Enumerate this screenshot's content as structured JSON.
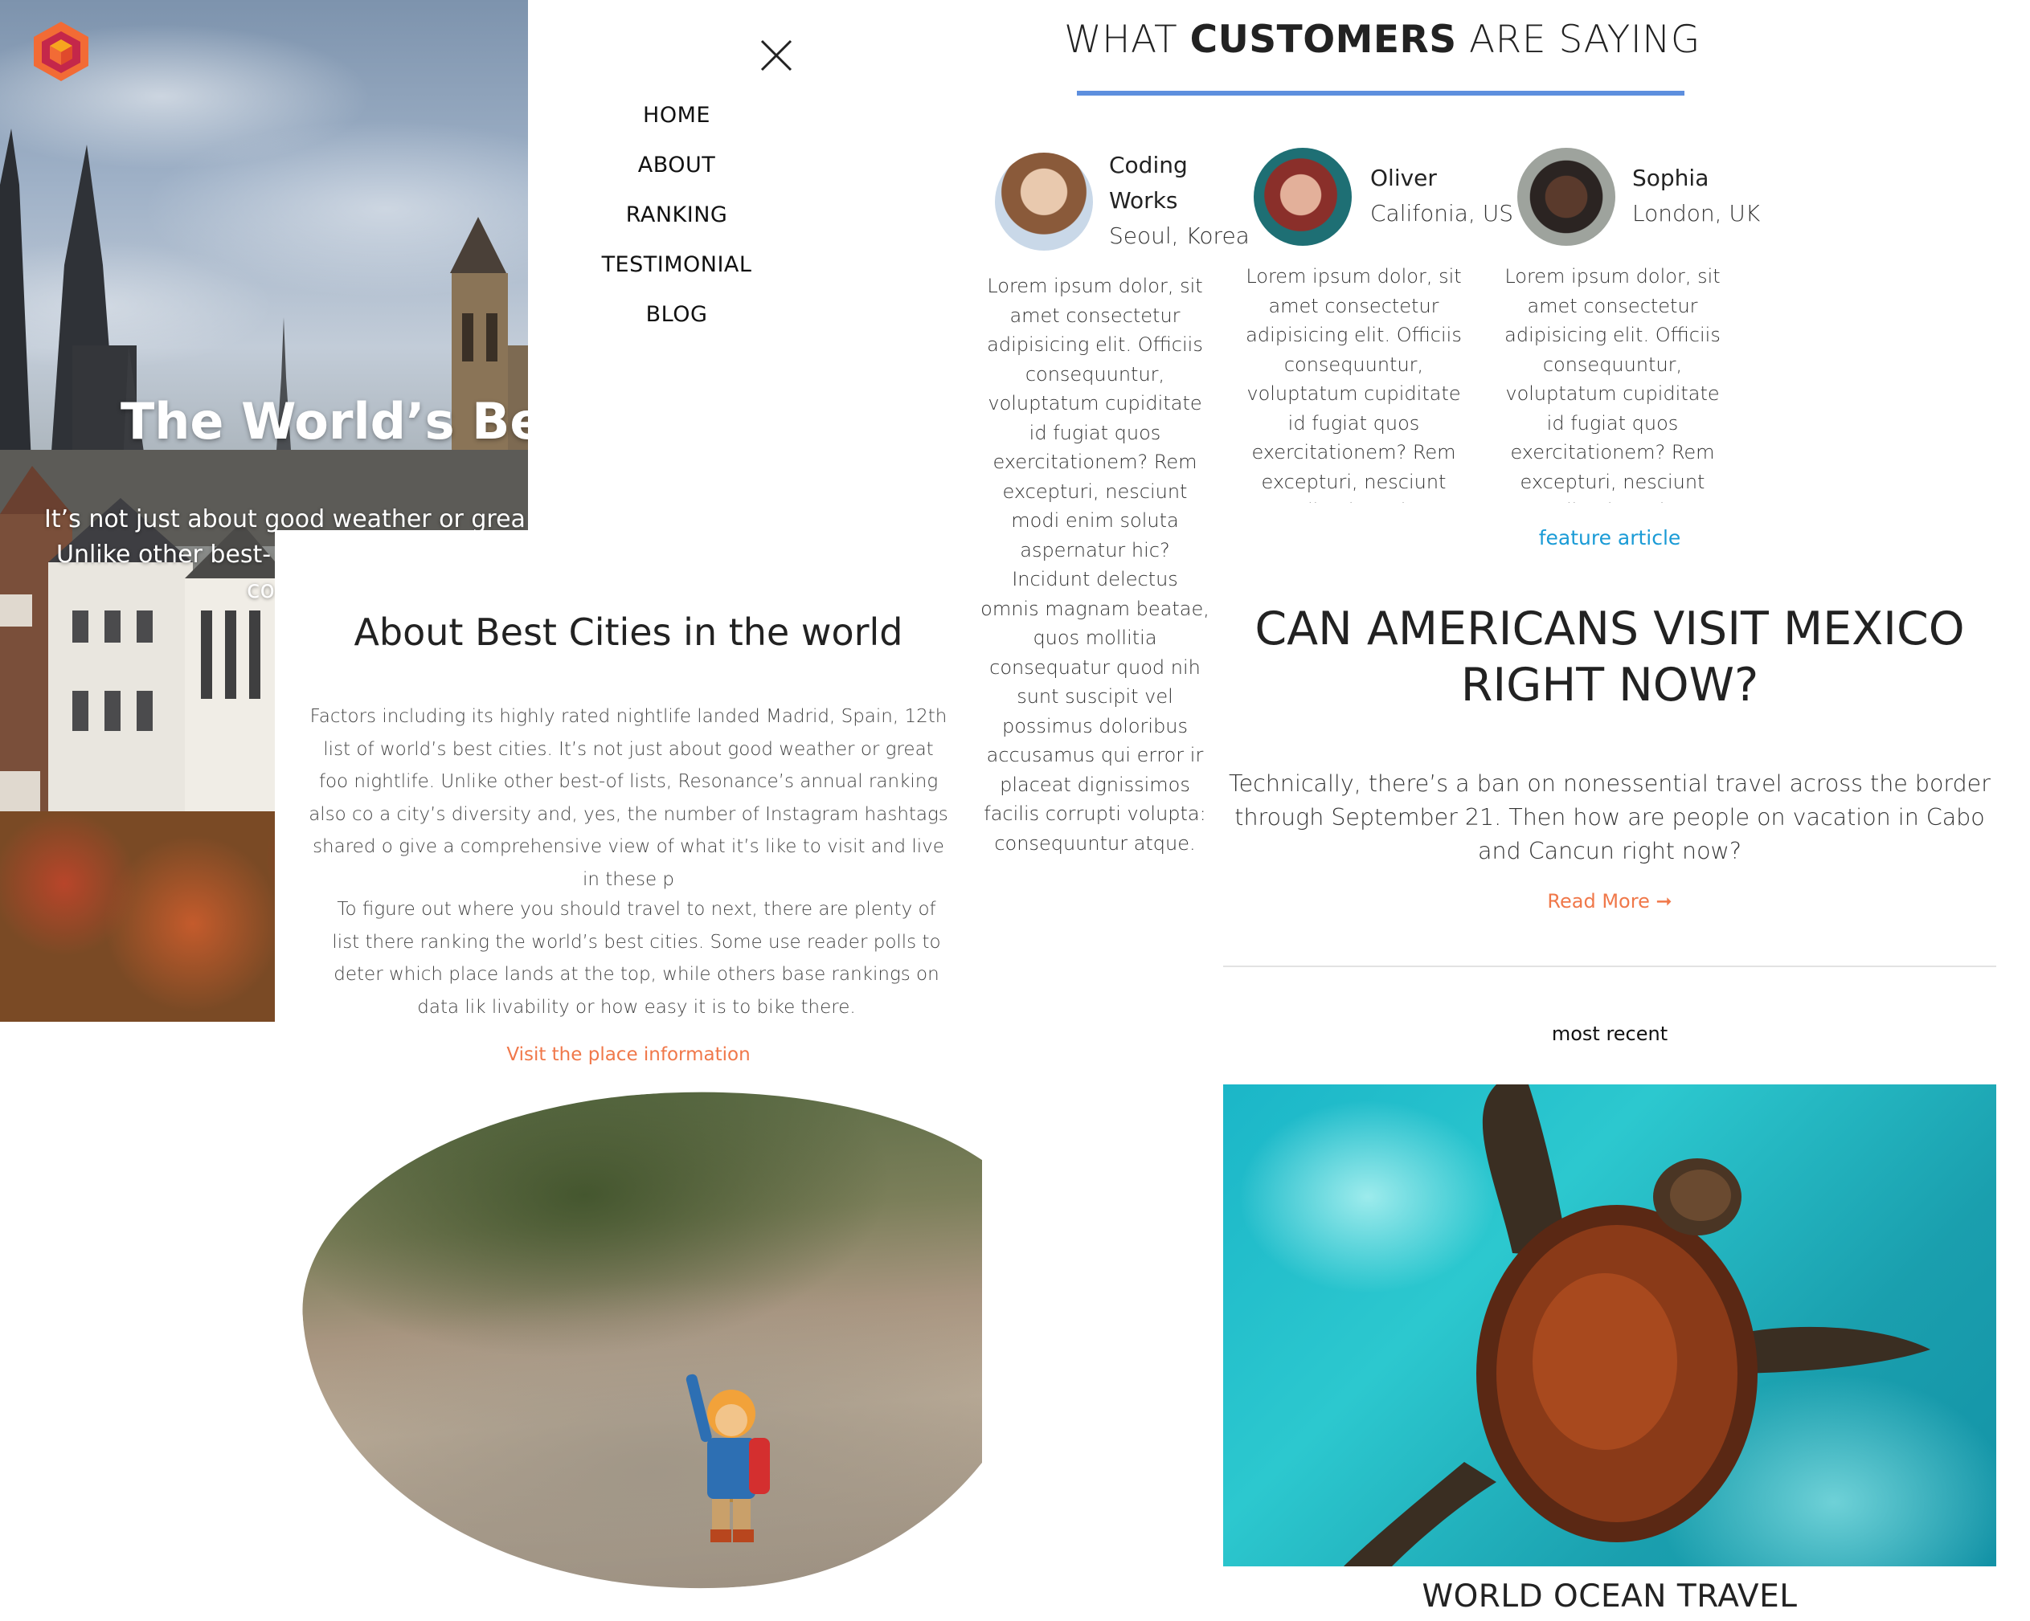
{
  "brand": {
    "logo": "hexagon-cube-logo",
    "colors": {
      "orange": "#f26b35",
      "red": "#c4274a"
    }
  },
  "hero": {
    "title": "The World’s Best",
    "subtitle_lines": [
      "It’s not just about good weather or grea",
      "Unlike other best-",
      "co"
    ]
  },
  "menu": {
    "close_icon": "close-icon",
    "items": [
      "HOME",
      "ABOUT",
      "RANKING",
      "TESTIMONIAL",
      "BLOG"
    ]
  },
  "about": {
    "title": "About Best Cities in the world",
    "paragraph1": "Factors including its highly rated nightlife landed Madrid, Spain, 12th list of world’s best cities. It’s not just about good weather or great foo nightlife. Unlike other best-of lists, Resonance’s annual ranking also co a city’s diversity and, yes, the number of Instagram hashtags shared o give a comprehensive view of what it’s like to visit and live in these p",
    "paragraph2": "To figure out where you should travel to next, there are plenty of list there ranking the world’s best cities. Some use reader polls to deter which place lands at the top, while others base rankings on data lik livability or how easy it is to bike there.",
    "link": "Visit the place information"
  },
  "testimonials": {
    "heading_pre": "WHAT ",
    "heading_bold": "CUSTOMERS",
    "heading_post": " ARE SAYING",
    "accent": "#5d8fde",
    "items": [
      {
        "name": "Coding Works",
        "location": "Seoul, Korea",
        "text": "Lorem ipsum dolor, sit amet consectetur adipisicing elit. Officiis consequuntur, voluptatum cupiditate id fugiat quos exercitationem? Rem excepturi, nesciunt modi enim soluta aspernatur hic? Incidunt delectus omnis magnam beatae, quos mollitia consequatur quod nih sunt suscipit vel possimus doloribus accusamus qui error ir placeat dignissimos facilis corrupti volupta: consequuntur atque."
      },
      {
        "name": "Oliver",
        "location": "Califonia, US",
        "text": "Lorem ipsum dolor, sit amet consectetur adipisicing elit. Officiis consequuntur, voluptatum cupiditate id fugiat quos exercitationem? Rem excepturi, nesciunt modi enim soluta"
      },
      {
        "name": "Sophia",
        "location": "London, UK",
        "text": "Lorem ipsum dolor, sit amet consectetur adipisicing elit. Officiis consequuntur, voluptatum cupiditate id fugiat quos exercitationem? Rem excepturi, nesciunt modi enim soluta"
      }
    ]
  },
  "feature": {
    "tag": "feature article",
    "title": "CAN AMERICANS VISIT MEXICO RIGHT NOW?",
    "body": "Technically, there’s a ban on nonessential travel across the border through September 21. Then how are people on vacation in Cabo and Cancun right now?",
    "read_more": "Read More ➞",
    "link_color": "#f0784a",
    "tag_color": "#1a9bd6"
  },
  "recent": {
    "label": "most recent",
    "title": "WORLD OCEAN TRAVEL"
  }
}
